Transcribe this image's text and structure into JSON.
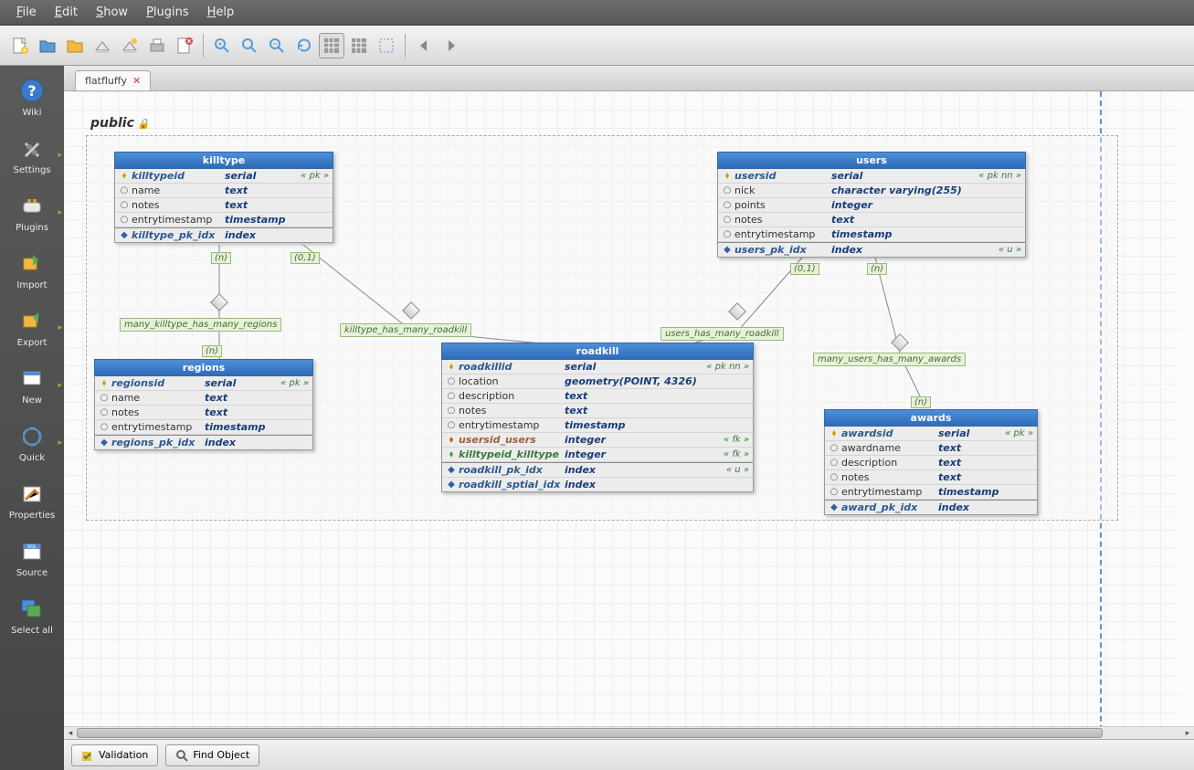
{
  "menu": [
    "File",
    "Edit",
    "Show",
    "Plugins",
    "Help"
  ],
  "leftbar": [
    "Wiki",
    "Settings",
    "Plugins",
    "Import",
    "Export",
    "New",
    "Quick",
    "Properties",
    "Source",
    "Select all"
  ],
  "tab": {
    "name": "flatfluffy"
  },
  "schema": "public",
  "status": {
    "validation": "Validation",
    "find": "Find Object"
  },
  "tables": {
    "killtype": {
      "title": "killtype",
      "cols": [
        {
          "ic": "pk",
          "n": "killtypeid",
          "t": "serial",
          "k": true,
          "c": "« pk »"
        },
        {
          "ic": "col",
          "n": "name",
          "t": "text"
        },
        {
          "ic": "col",
          "n": "notes",
          "t": "text"
        },
        {
          "ic": "col",
          "n": "entrytimestamp",
          "t": "timestamp"
        }
      ],
      "idx": [
        {
          "n": "killtype_pk_idx",
          "t": "index"
        }
      ]
    },
    "users": {
      "title": "users",
      "cols": [
        {
          "ic": "pk",
          "n": "usersid",
          "t": "serial",
          "k": true,
          "c": "« pk nn »"
        },
        {
          "ic": "col",
          "n": "nick",
          "t": "character varying(255)"
        },
        {
          "ic": "col",
          "n": "points",
          "t": "integer"
        },
        {
          "ic": "col",
          "n": "notes",
          "t": "text"
        },
        {
          "ic": "col",
          "n": "entrytimestamp",
          "t": "timestamp"
        }
      ],
      "idx": [
        {
          "n": "users_pk_idx",
          "t": "index",
          "c": "« u »"
        }
      ]
    },
    "regions": {
      "title": "regions",
      "cols": [
        {
          "ic": "pk",
          "n": "regionsid",
          "t": "serial",
          "k": true,
          "c": "« pk »"
        },
        {
          "ic": "col",
          "n": "name",
          "t": "text"
        },
        {
          "ic": "col",
          "n": "notes",
          "t": "text"
        },
        {
          "ic": "col",
          "n": "entrytimestamp",
          "t": "timestamp"
        }
      ],
      "idx": [
        {
          "n": "regions_pk_idx",
          "t": "index"
        }
      ]
    },
    "roadkill": {
      "title": "roadkill",
      "cols": [
        {
          "ic": "pk",
          "n": "roadkillid",
          "t": "serial",
          "k": true,
          "c": "« pk nn »"
        },
        {
          "ic": "col",
          "n": "location",
          "t": "geometry(POINT, 4326)"
        },
        {
          "ic": "col",
          "n": "description",
          "t": "text"
        },
        {
          "ic": "col",
          "n": "notes",
          "t": "text"
        },
        {
          "ic": "col",
          "n": "entrytimestamp",
          "t": "timestamp"
        },
        {
          "ic": "fk",
          "n": "usersid_users",
          "t": "integer",
          "k": true,
          "c": "« fk »"
        },
        {
          "ic": "fkg",
          "n": "killtypeid_killtype",
          "t": "integer",
          "k": true,
          "c": "« fk »"
        }
      ],
      "idx": [
        {
          "n": "roadkill_pk_idx",
          "t": "index",
          "c": "« u »"
        },
        {
          "n": "roadkill_sptial_idx",
          "t": "index"
        }
      ]
    },
    "awards": {
      "title": "awards",
      "cols": [
        {
          "ic": "pk",
          "n": "awardsid",
          "t": "serial",
          "k": true,
          "c": "« pk »"
        },
        {
          "ic": "col",
          "n": "awardname",
          "t": "text"
        },
        {
          "ic": "col",
          "n": "description",
          "t": "text"
        },
        {
          "ic": "col",
          "n": "notes",
          "t": "text"
        },
        {
          "ic": "col",
          "n": "entrytimestamp",
          "t": "timestamp"
        }
      ],
      "idx": [
        {
          "n": "award_pk_idx",
          "t": "index"
        }
      ]
    }
  },
  "rels": [
    {
      "label": "many_killtype_has_many_regions"
    },
    {
      "label": "killtype_has_many_roadkill"
    },
    {
      "label": "users_has_many_roadkill"
    },
    {
      "label": "many_users_has_many_awards"
    }
  ],
  "card": {
    "n": "(n)",
    "z": "(0,1)"
  }
}
